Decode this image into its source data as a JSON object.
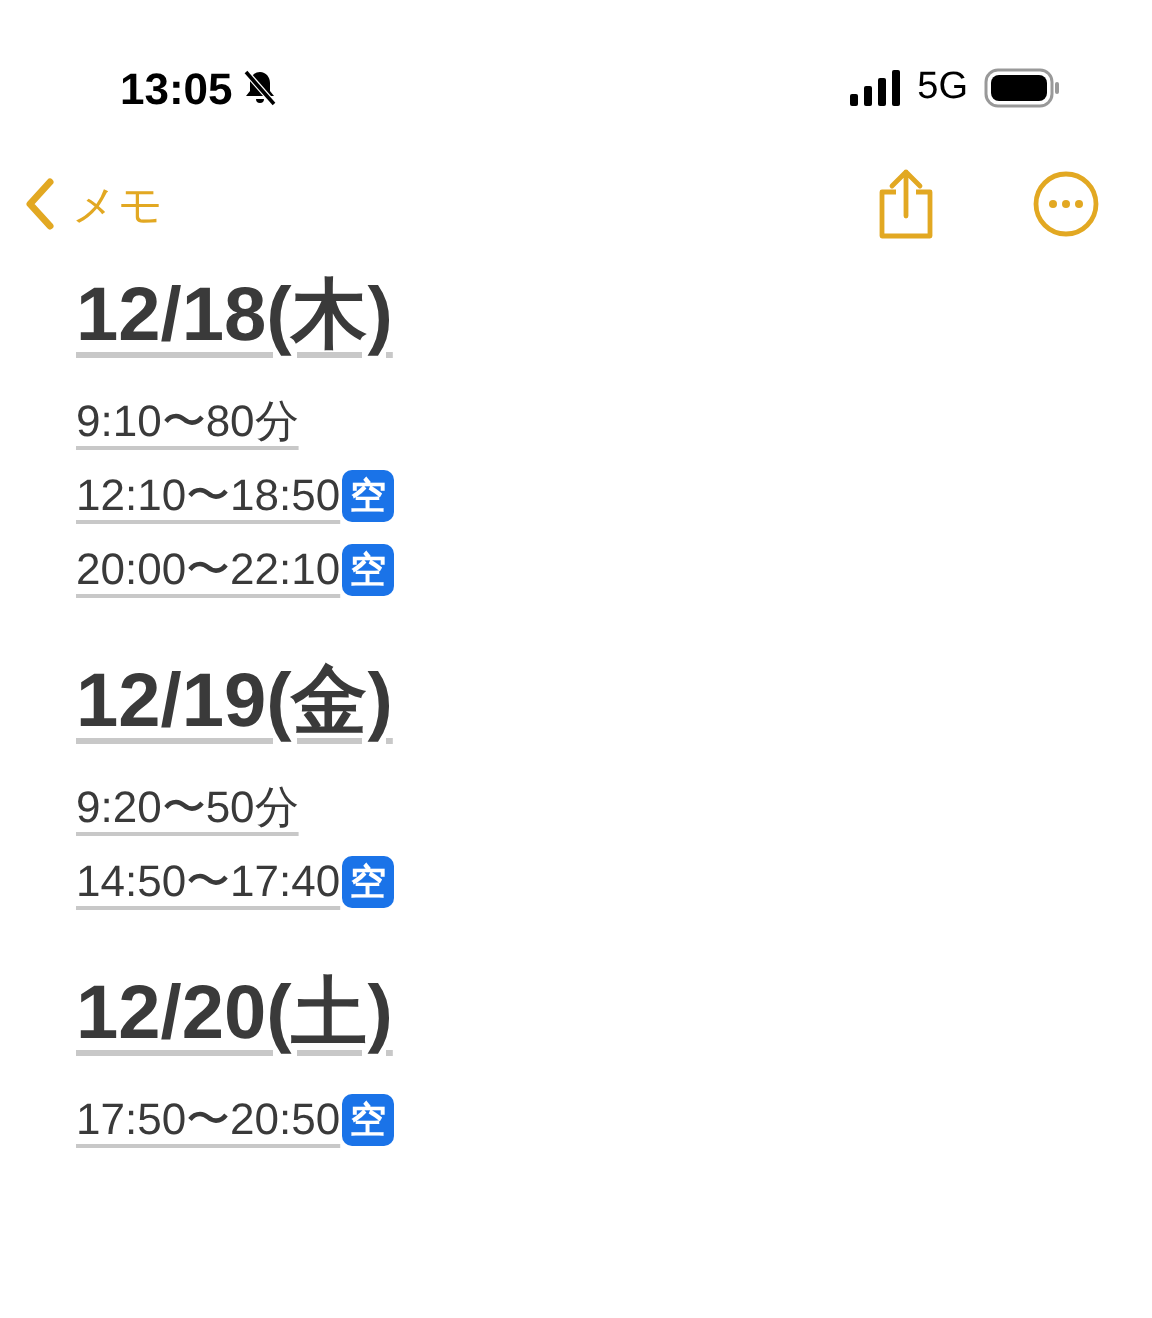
{
  "status_bar": {
    "time": "13:05",
    "network": "5G"
  },
  "nav": {
    "back_label": "メモ"
  },
  "sections": [
    {
      "heading": "12/18(木)",
      "lines": [
        {
          "text": "9:10〜80分"
        },
        {
          "text": "12:10〜18:50",
          "badge": "空"
        },
        {
          "text": "20:00〜22:10",
          "badge": "空"
        }
      ]
    },
    {
      "heading": "12/19(金)",
      "lines": [
        {
          "text": "9:20〜50分"
        },
        {
          "text": "14:50〜17:40",
          "badge": "空"
        }
      ]
    },
    {
      "heading": "12/20(土)",
      "lines": [
        {
          "text": "17:50〜20:50",
          "badge": "空"
        }
      ]
    }
  ]
}
